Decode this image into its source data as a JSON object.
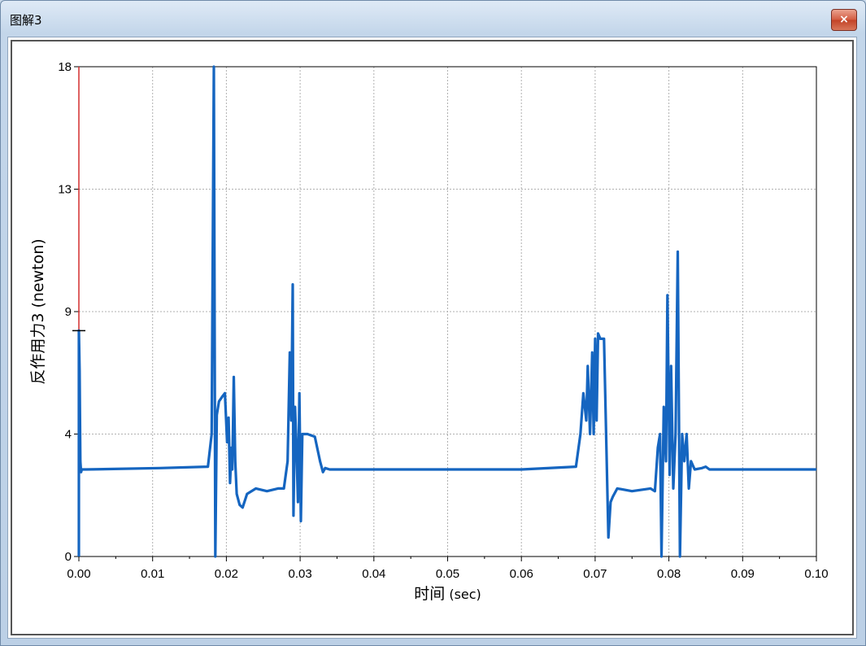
{
  "window": {
    "title": "图解3",
    "close_glyph": "×",
    "close_icon": "close-icon"
  },
  "colors": {
    "series": "#1565c0",
    "grid": "#b0b0b0",
    "cursor": "#d32f2f",
    "axis": "#000000"
  },
  "chart_data": {
    "type": "line",
    "title": "",
    "xlabel": "时间",
    "xlabel_unit": "(sec)",
    "ylabel": "反作用力3 (newton)",
    "xlim": [
      0.0,
      0.1
    ],
    "ylim": [
      0,
      18
    ],
    "x_ticks": [
      "0.00",
      "0.01",
      "0.02",
      "0.03",
      "0.04",
      "0.05",
      "0.06",
      "0.07",
      "0.08",
      "0.09",
      "0.10"
    ],
    "y_ticks": [
      {
        "value": 0,
        "label": "0"
      },
      {
        "value": 4.5,
        "label": "4"
      },
      {
        "value": 9,
        "label": "9"
      },
      {
        "value": 13.5,
        "label": "13"
      },
      {
        "value": 18,
        "label": "18"
      }
    ],
    "grid": true,
    "cursor_x": 0.0,
    "series": [
      {
        "x": [
          0.0,
          0.0,
          0.0001,
          0.0002,
          0.0003,
          0.0004,
          0.0006,
          0.001,
          0.011,
          0.0175,
          0.018,
          0.0183,
          0.0185,
          0.0187,
          0.019,
          0.0195,
          0.0198,
          0.0201,
          0.0203,
          0.0205,
          0.0207,
          0.0208,
          0.021,
          0.0212,
          0.0214,
          0.0218,
          0.0222,
          0.0228,
          0.024,
          0.0255,
          0.027,
          0.0278,
          0.0283,
          0.0286,
          0.0288,
          0.029,
          0.0291,
          0.0293,
          0.0295,
          0.0297,
          0.0299,
          0.0301,
          0.0303,
          0.0305,
          0.031,
          0.032,
          0.0327,
          0.0331,
          0.0334,
          0.034,
          0.045,
          0.06,
          0.0674,
          0.068,
          0.0684,
          0.0688,
          0.069,
          0.0693,
          0.0696,
          0.0698,
          0.07,
          0.0702,
          0.0704,
          0.0707,
          0.0712,
          0.0718,
          0.0721,
          0.0724,
          0.073,
          0.075,
          0.0775,
          0.0781,
          0.0785,
          0.0788,
          0.079,
          0.0793,
          0.0796,
          0.0798,
          0.0801,
          0.0803,
          0.0806,
          0.0809,
          0.0812,
          0.0815,
          0.0818,
          0.0821,
          0.0824,
          0.0827,
          0.083,
          0.0835,
          0.0845,
          0.085,
          0.0855,
          0.1
        ],
        "y": [
          0,
          8.3,
          6.8,
          3.5,
          3.1,
          3.2,
          3.2,
          3.2,
          3.25,
          3.3,
          4.5,
          18,
          0,
          5.2,
          5.7,
          5.9,
          6.0,
          4.2,
          5.1,
          2.7,
          4.0,
          3.2,
          6.6,
          3.5,
          2.3,
          1.9,
          1.8,
          2.3,
          2.5,
          2.4,
          2.5,
          2.5,
          3.5,
          7.5,
          5.0,
          10.0,
          1.5,
          5.5,
          4.0,
          2.0,
          6.0,
          1.3,
          4.5,
          4.5,
          4.5,
          4.4,
          3.5,
          3.1,
          3.25,
          3.2,
          3.2,
          3.2,
          3.3,
          4.5,
          6.0,
          5.0,
          7.0,
          4.5,
          7.5,
          4.5,
          8.0,
          5.0,
          8.2,
          8.0,
          8.0,
          0.7,
          2.0,
          2.2,
          2.5,
          2.4,
          2.5,
          2.4,
          4.0,
          4.5,
          0,
          5.5,
          3.5,
          9.6,
          3.0,
          7.0,
          2.5,
          4.5,
          11.2,
          0,
          4.5,
          3.5,
          4.5,
          2.5,
          3.5,
          3.2,
          3.25,
          3.3,
          3.2,
          3.2
        ]
      }
    ]
  }
}
